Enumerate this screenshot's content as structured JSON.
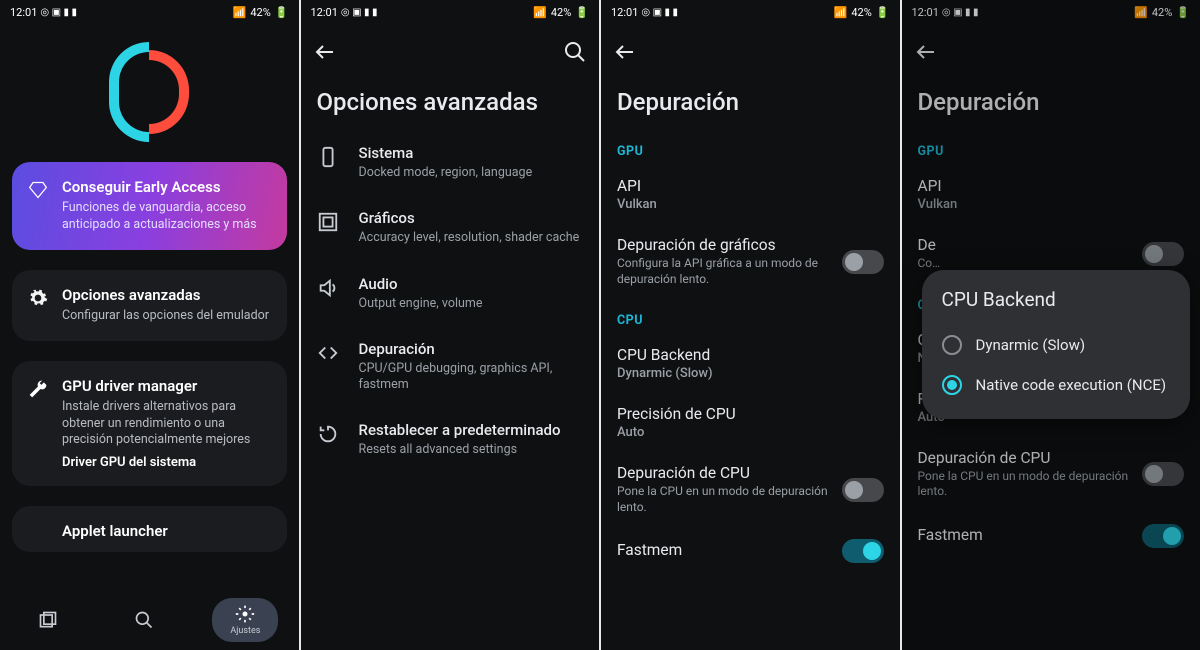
{
  "status": {
    "time": "12:01",
    "battery": "42%"
  },
  "screen1": {
    "ea": {
      "title": "Conseguir Early Access",
      "sub": "Funciones de vanguardia, acceso anticipado a actualizaciones y más"
    },
    "adv": {
      "title": "Opciones avanzadas",
      "sub": "Configurar las opciones del emulador"
    },
    "gpu": {
      "title": "GPU driver manager",
      "sub": "Instale drivers alternativos para obtener un rendimiento o una precisión potencialmente mejores",
      "strong": "Driver GPU del sistema"
    },
    "applet": {
      "title": "Applet launcher"
    },
    "nav_settings": "Ajustes"
  },
  "screen2": {
    "title": "Opciones avanzadas",
    "rows": {
      "sistema": {
        "t": "Sistema",
        "s": "Docked mode, region, language"
      },
      "graficos": {
        "t": "Gráficos",
        "s": "Accuracy level, resolution, shader cache"
      },
      "audio": {
        "t": "Audio",
        "s": "Output engine, volume"
      },
      "dep": {
        "t": "Depuración",
        "s": "CPU/GPU debugging, graphics API, fastmem"
      },
      "reset": {
        "t": "Restablecer a predeterminado",
        "s": "Resets all advanced settings"
      }
    }
  },
  "screen3": {
    "title": "Depuración",
    "gpu_hdr": "GPU",
    "api": {
      "t": "API",
      "v": "Vulkan"
    },
    "graf_dbg": {
      "t": "Depuración de gráficos",
      "s": "Configura la API gráfica a un modo de depuración lento."
    },
    "cpu_hdr": "CPU",
    "backend": {
      "t": "CPU Backend",
      "v": "Dynarmic (Slow)"
    },
    "precision": {
      "t": "Precisión de CPU",
      "v": "Auto"
    },
    "cpu_dbg": {
      "t": "Depuración de CPU",
      "s": "Pone la CPU en un modo de depuración lento."
    },
    "fastmem": {
      "t": "Fastmem"
    }
  },
  "screen4": {
    "title": "Depuración",
    "gpu_hdr": "GPU",
    "api": {
      "t": "API",
      "v": "Vulkan"
    },
    "graf_dbg": {
      "t": "De",
      "s": "Co…"
    },
    "cpu_hdr": "CP",
    "backend": {
      "t": "C",
      "v": "Native code execution (NCE)"
    },
    "precision": {
      "t": "Precisión de CPU",
      "v": "Auto"
    },
    "cpu_dbg": {
      "t": "Depuración de CPU",
      "s": "Pone la CPU en un modo de depuración lento."
    },
    "fastmem": {
      "t": "Fastmem"
    },
    "dialog": {
      "title": "CPU Backend",
      "opt1": "Dynarmic (Slow)",
      "opt2": "Native code execution (NCE)"
    }
  }
}
